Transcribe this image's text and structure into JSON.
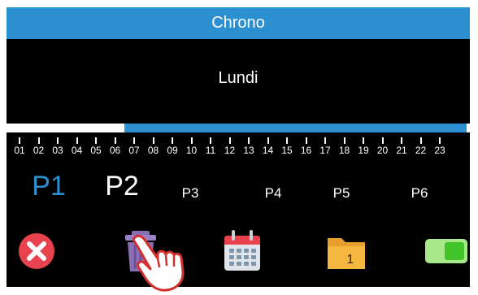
{
  "header": {
    "title": "Chrono"
  },
  "day": "Lundi",
  "timeline": {
    "active_range_hours": [
      6,
      24
    ],
    "hours": [
      "01",
      "02",
      "03",
      "04",
      "05",
      "06",
      "07",
      "08",
      "09",
      "10",
      "11",
      "12",
      "13",
      "14",
      "15",
      "16",
      "17",
      "18",
      "19",
      "20",
      "21",
      "22",
      "23"
    ]
  },
  "programs": [
    {
      "label": "P1",
      "style": "big-active"
    },
    {
      "label": "P2",
      "style": "big"
    },
    {
      "label": "P3",
      "style": "small"
    },
    {
      "label": "P4",
      "style": "small"
    },
    {
      "label": "P5",
      "style": "small"
    },
    {
      "label": "P6",
      "style": "small"
    }
  ],
  "toolbar": {
    "file_number": "1",
    "icons": [
      "close-icon",
      "trash-icon",
      "calendar-icon",
      "folder-icon",
      "toggle-icon"
    ]
  },
  "colors": {
    "title_bar": "#2b8fd0",
    "active_program": "#2b8fd0",
    "screen_bg": "#000000",
    "close": "#e8424f",
    "trash": "#8a6fb5",
    "calendar_rings": "#e8424f",
    "folder": "#f4b63f",
    "toggle": "#7ed957"
  }
}
